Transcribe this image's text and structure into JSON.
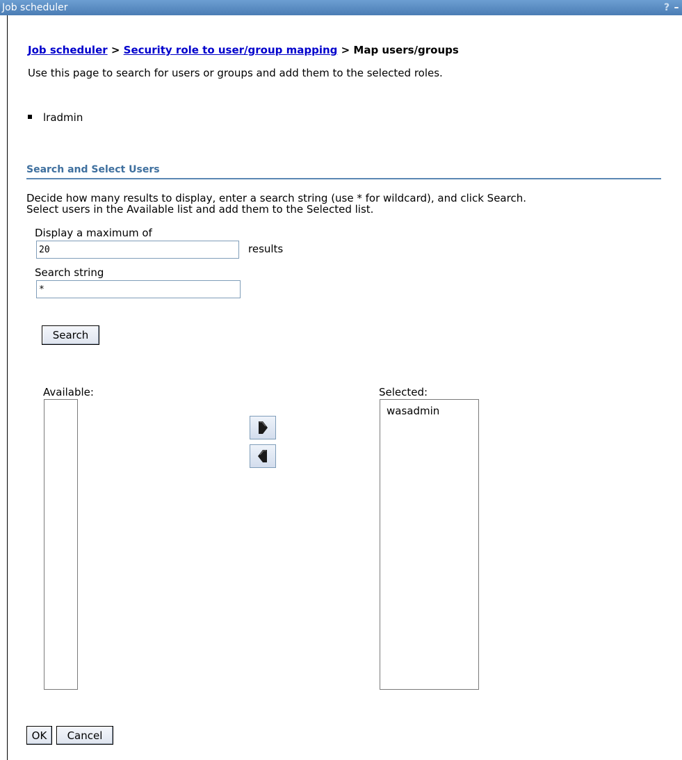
{
  "window": {
    "title": "Job scheduler",
    "help_glyph": "?",
    "minimize_glyph": "–"
  },
  "breadcrumb": {
    "link1": "Job scheduler",
    "sep1": " > ",
    "link2": "Security role to user/group mapping",
    "sep2": " > ",
    "current": "Map users/groups"
  },
  "intro": "Use this page to search for users or groups and add them to the selected roles.",
  "roles": [
    "lradmin"
  ],
  "section": {
    "title": "Search and Select Users",
    "desc_line1": "Decide how many results to display, enter a search string (use * for wildcard), and click Search.",
    "desc_line2": "Select users in the Available list and add them to the Selected list."
  },
  "form": {
    "max_label": "Display a maximum of",
    "max_value": "20",
    "results_label": "results",
    "search_label": "Search string",
    "search_value": "*",
    "search_button": "Search"
  },
  "lists": {
    "available_label": "Available:",
    "available_items": [],
    "selected_label": "Selected:",
    "selected_items": [
      "wasadmin"
    ],
    "add_icon": "arrow-right-icon",
    "remove_icon": "arrow-left-icon"
  },
  "actions": {
    "ok": "OK",
    "cancel": "Cancel"
  },
  "colors": {
    "titlebar": "#5a8cc4",
    "link": "#0000cc",
    "section_title": "#3e6f9e"
  }
}
